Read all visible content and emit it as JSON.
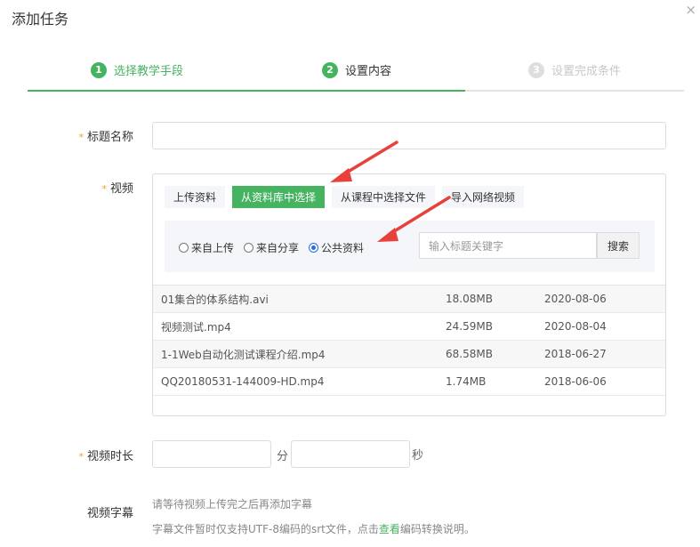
{
  "dialog": {
    "title": "添加任务",
    "close": "×"
  },
  "steps": [
    {
      "num": "1",
      "label": "选择教学手段",
      "state": "done"
    },
    {
      "num": "2",
      "label": "设置内容",
      "state": "current"
    },
    {
      "num": "3",
      "label": "设置完成条件",
      "state": "pending"
    }
  ],
  "form": {
    "title_label": "标题名称",
    "title_value": "",
    "video_label": "视频",
    "duration_label": "视频时长",
    "minutes_unit": "分",
    "seconds_unit": "秒",
    "subtitle_label": "视频字幕",
    "required_mark": "*"
  },
  "video": {
    "tabs": [
      {
        "label": "上传资料",
        "active": false
      },
      {
        "label": "从资料库中选择",
        "active": true
      },
      {
        "label": "从课程中选择文件",
        "active": false
      },
      {
        "label": "导入网络视频",
        "active": false
      }
    ],
    "radios": [
      {
        "label": "来自上传",
        "checked": false
      },
      {
        "label": "来自分享",
        "checked": false
      },
      {
        "label": "公共资料",
        "checked": true
      }
    ],
    "search_placeholder": "输入标题关键字",
    "search_button": "搜索",
    "files": [
      {
        "name": "01集合的体系结构.avi",
        "size": "18.08MB",
        "date": "2020-08-06"
      },
      {
        "name": "视频测试.mp4",
        "size": "24.59MB",
        "date": "2020-08-04"
      },
      {
        "name": "1-1Web自动化测试课程介绍.mp4",
        "size": "68.58MB",
        "date": "2018-06-27"
      },
      {
        "name": "QQ20180531-144009-HD.mp4",
        "size": "1.74MB",
        "date": "2018-06-06"
      }
    ]
  },
  "subtitle": {
    "hint": "请等待视频上传完之后再添加字幕",
    "note_prefix": "字幕文件暂时仅支持UTF-8编码的srt文件，点击",
    "note_link": "查看",
    "note_suffix": "编码转换说明。"
  },
  "colors": {
    "accent": "#46b361",
    "arrow": "#e8403a",
    "required": "#f0a030"
  }
}
